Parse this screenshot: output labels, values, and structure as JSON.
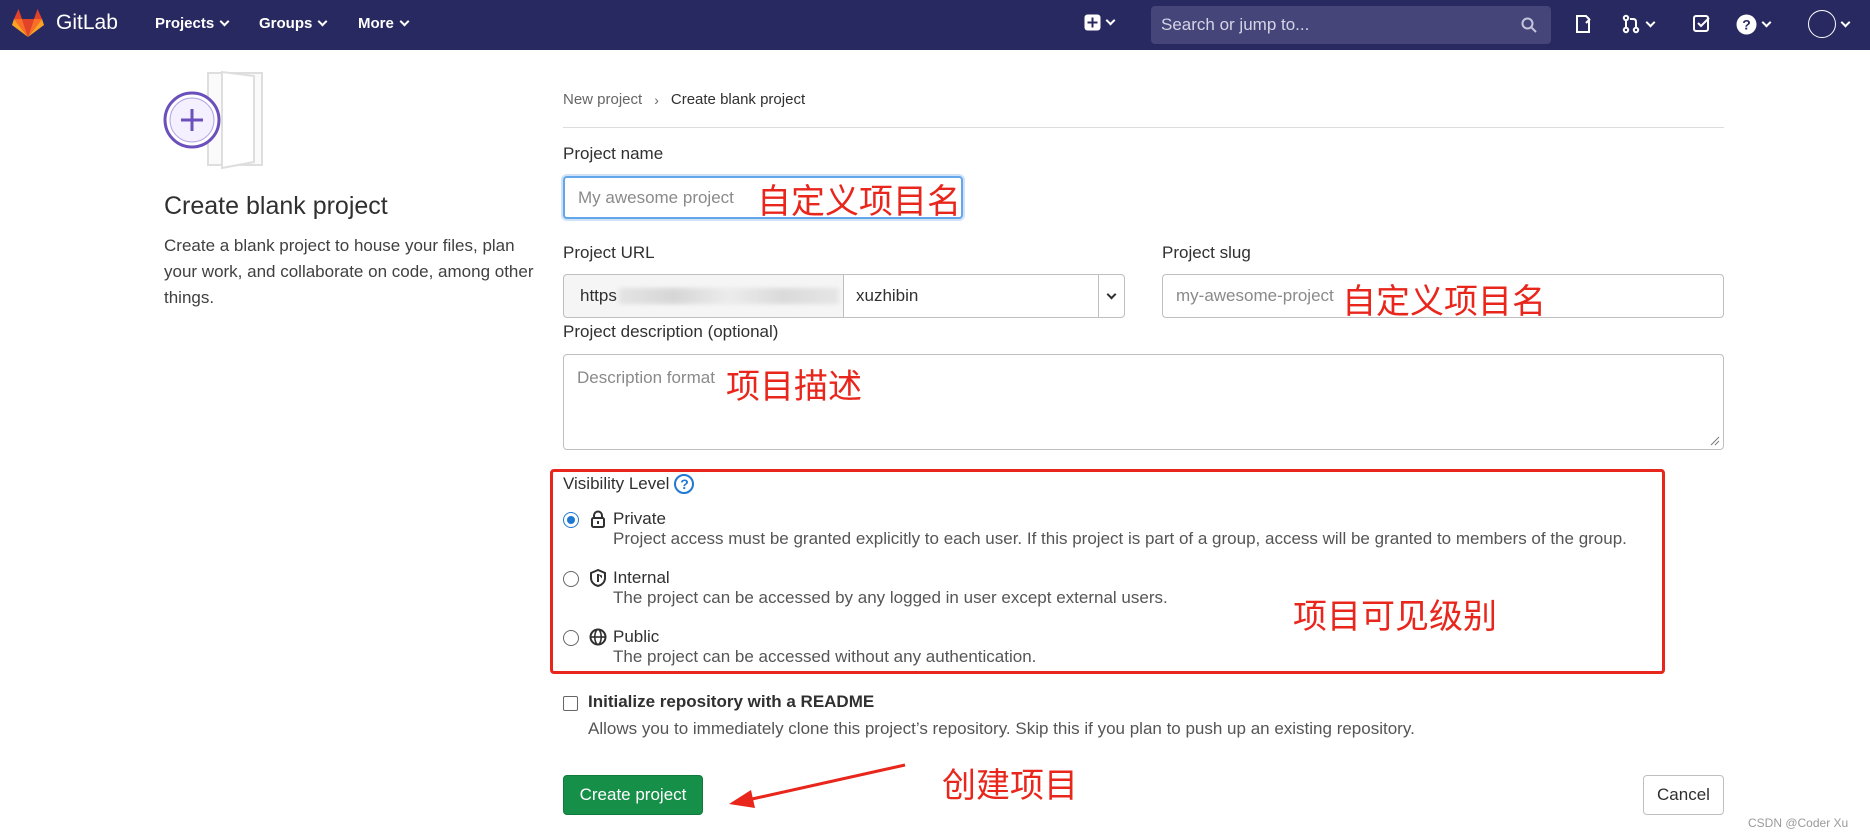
{
  "nav": {
    "brand": "GitLab",
    "items": [
      {
        "label": "Projects"
      },
      {
        "label": "Groups"
      },
      {
        "label": "More"
      }
    ],
    "search_placeholder": "Search or jump to...",
    "icons": [
      "plus-square-icon",
      "search-icon",
      "issues-icon",
      "merge-request-icon",
      "todo-icon",
      "help-icon",
      "avatar"
    ]
  },
  "sidebar": {
    "title": "Create blank project",
    "description": "Create a blank project to house your files, plan your work, and collaborate on code, among other things."
  },
  "breadcrumb": {
    "parent": "New project",
    "separator": "›",
    "current": "Create blank project"
  },
  "form": {
    "project_name": {
      "label": "Project name",
      "placeholder": "My awesome project",
      "value": ""
    },
    "project_url": {
      "label": "Project URL",
      "prefix": "https",
      "namespace": "xuzhibin"
    },
    "project_slug": {
      "label": "Project slug",
      "placeholder": "my-awesome-project",
      "value": ""
    },
    "description": {
      "label": "Project description (optional)",
      "placeholder": "Description format"
    },
    "visibility": {
      "title": "Visibility Level",
      "help_glyph": "?",
      "options": [
        {
          "name": "Private",
          "icon": "lock-icon",
          "checked": true,
          "description": "Project access must be granted explicitly to each user. If this project is part of a group, access will be granted to members of the group."
        },
        {
          "name": "Internal",
          "icon": "shield-icon",
          "checked": false,
          "description": "The project can be accessed by any logged in user except external users."
        },
        {
          "name": "Public",
          "icon": "globe-icon",
          "checked": false,
          "description": "The project can be accessed without any authentication."
        }
      ]
    },
    "readme": {
      "label": "Initialize repository with a README",
      "description": "Allows you to immediately clone this project’s repository. Skip this if you plan to push up an existing repository.",
      "checked": false
    },
    "submit_label": "Create project",
    "cancel_label": "Cancel"
  },
  "annotations": {
    "name_note": "自定义项目名",
    "slug_note": "自定义项目名",
    "description_note": "项目描述",
    "visibility_note": "项目可见级别",
    "create_note": "创建项目",
    "accent": "#e8261c"
  },
  "watermark": "CSDN @Coder Xu",
  "colors": {
    "nav_bg": "#292961",
    "primary_button": "#168f48",
    "link_blue": "#1f78d1"
  }
}
